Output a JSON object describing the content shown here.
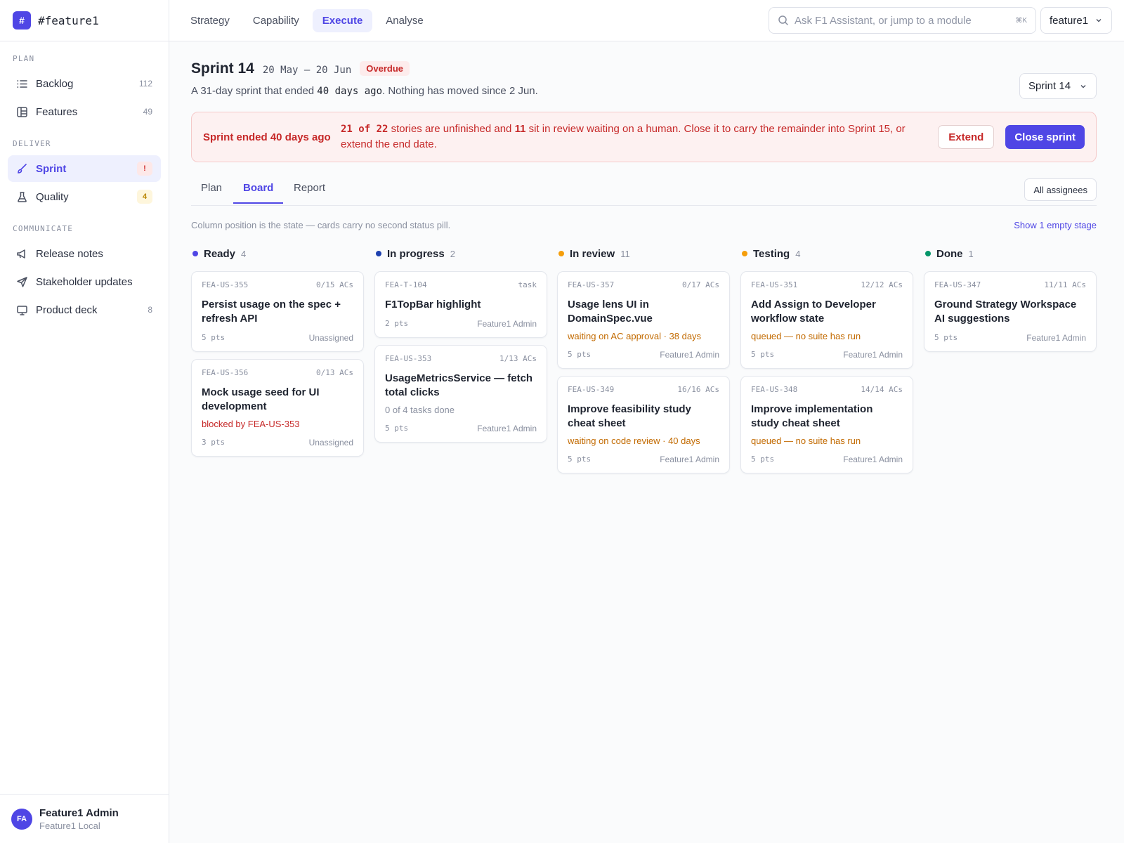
{
  "brand": {
    "name": "#feature1",
    "badge": "#"
  },
  "sidebar": {
    "sections": [
      {
        "heading": "PLAN",
        "items": [
          {
            "label": "Backlog",
            "count": "112",
            "icon": "list-icon"
          },
          {
            "label": "Features",
            "count": "49",
            "icon": "layout-icon"
          }
        ]
      },
      {
        "heading": "DELIVER",
        "items": [
          {
            "label": "Sprint",
            "badge": "!",
            "icon": "brush-icon",
            "active": true
          },
          {
            "label": "Quality",
            "badge": "4",
            "icon": "flask-icon"
          }
        ]
      },
      {
        "heading": "COMMUNICATE",
        "items": [
          {
            "label": "Release notes",
            "icon": "megaphone-icon"
          },
          {
            "label": "Stakeholder updates",
            "icon": "send-icon"
          },
          {
            "label": "Product deck",
            "count": "8",
            "icon": "monitor-icon"
          }
        ]
      }
    ],
    "user": {
      "initials": "FA",
      "name": "Feature1 Admin",
      "sub": "Feature1 Local"
    }
  },
  "topbar": {
    "tabs": [
      "Strategy",
      "Capability",
      "Execute",
      "Analyse"
    ],
    "active_tab": "Execute",
    "search_placeholder": "Ask F1 Assistant, or jump to a module",
    "search_shortcut": "⌘K",
    "workspace": "feature1"
  },
  "sprint": {
    "title": "Sprint 14",
    "dates": "20 May – 20 Jun",
    "status": "Overdue",
    "sub_before": "A 31-day sprint that ended ",
    "sub_mono": "40 days ago",
    "sub_after": ". Nothing has moved since 2 Jun.",
    "selector": "Sprint 14"
  },
  "alert": {
    "title": "Sprint ended 40 days ago",
    "msg_count": "21 of 22",
    "msg_part1": " stories are unfinished and ",
    "msg_review": "11",
    "msg_part2": " sit in review waiting on a human. Close it to carry the remainder into Sprint 15, or extend the end date.",
    "extend_label": "Extend",
    "close_label": "Close sprint"
  },
  "subtabs": {
    "items": [
      "Plan",
      "Board",
      "Report"
    ],
    "active": "Board",
    "assignees": "All assignees"
  },
  "hint": "Column position is the state — cards carry no second status pill.",
  "show_empty": "Show 1 empty stage",
  "colors": {
    "accent": "#4f46e5",
    "danger": "#c62828",
    "warning": "#c26a00",
    "ready": "#4f46e5",
    "progress": "#1e40af",
    "review": "#f59e0b",
    "testing": "#f59e0b",
    "done": "#059669"
  },
  "columns": [
    {
      "name": "Ready",
      "count": "4",
      "color": "#4f46e5",
      "cards": [
        {
          "id": "FEA-US-355",
          "meta": "0/15 ACs",
          "title": "Persist usage on the spec + refresh API",
          "pts": "5 pts",
          "owner": "Unassigned"
        },
        {
          "id": "FEA-US-356",
          "meta": "0/13 ACs",
          "title": "Mock usage seed for UI development",
          "note": "blocked by FEA-US-353",
          "note_type": "red",
          "pts": "3 pts",
          "owner": "Unassigned"
        }
      ]
    },
    {
      "name": "In progress",
      "count": "2",
      "color": "#1e40af",
      "cards": [
        {
          "id": "FEA-T-104",
          "meta": "task",
          "title": "F1TopBar highlight",
          "pts": "2 pts",
          "owner": "Feature1 Admin"
        },
        {
          "id": "FEA-US-353",
          "meta": "1/13 ACs",
          "title": "UsageMetricsService — fetch total clicks",
          "note": "0 of 4 tasks done",
          "note_type": "gray",
          "pts": "5 pts",
          "owner": "Feature1 Admin"
        }
      ]
    },
    {
      "name": "In review",
      "count": "11",
      "color": "#f59e0b",
      "cards": [
        {
          "id": "FEA-US-357",
          "meta": "0/17 ACs",
          "title": "Usage lens UI in DomainSpec.vue",
          "note": "waiting on AC approval · 38 days",
          "note_type": "orange",
          "pts": "5 pts",
          "owner": "Feature1 Admin"
        },
        {
          "id": "FEA-US-349",
          "meta": "16/16 ACs",
          "title": "Improve feasibility study cheat sheet",
          "note": "waiting on code review · 40 days",
          "note_type": "orange",
          "pts": "5 pts",
          "owner": "Feature1 Admin"
        }
      ]
    },
    {
      "name": "Testing",
      "count": "4",
      "color": "#f59e0b",
      "cards": [
        {
          "id": "FEA-US-351",
          "meta": "12/12 ACs",
          "title": "Add Assign to Developer workflow state",
          "note": "queued — no suite has run",
          "note_type": "orange",
          "pts": "5 pts",
          "owner": "Feature1 Admin"
        },
        {
          "id": "FEA-US-348",
          "meta": "14/14 ACs",
          "title": "Improve implementation study cheat sheet",
          "note": "queued — no suite has run",
          "note_type": "orange",
          "pts": "5 pts",
          "owner": "Feature1 Admin"
        }
      ]
    },
    {
      "name": "Done",
      "count": "1",
      "color": "#059669",
      "cards": [
        {
          "id": "FEA-US-347",
          "meta": "11/11 ACs",
          "title": "Ground Strategy Workspace AI suggestions",
          "pts": "5 pts",
          "owner": "Feature1 Admin"
        }
      ]
    }
  ]
}
